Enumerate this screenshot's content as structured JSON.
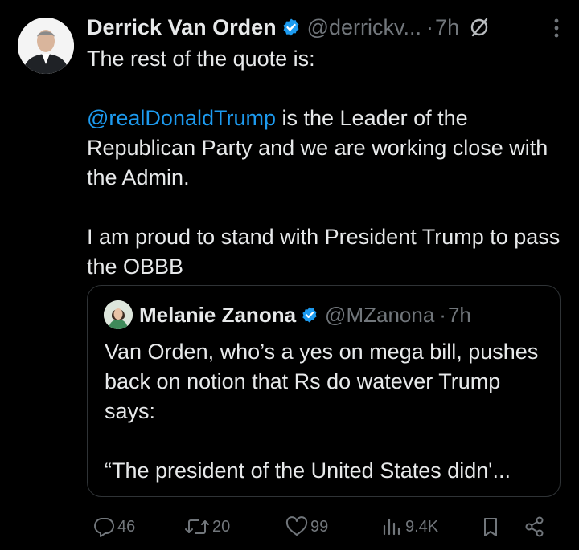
{
  "post": {
    "author_name": "Derrick Van Orden",
    "author_handle": "@derrickv...",
    "separator": "·",
    "time": "7h",
    "paragraphs": {
      "p1": "The rest of the quote is:",
      "p2_mention": "@realDonaldTrump",
      "p2_text": " is the Leader of the Republican Party and we are working close with the Admin.",
      "p3": "I am proud to stand with President Trump to pass the OBBB"
    }
  },
  "quoted_post": {
    "author_name": "Melanie Zanona",
    "author_handle": "@MZanona",
    "separator": "·",
    "time": "7h",
    "p1": "Van Orden, who’s a yes on mega bill, pushes back on notion that Rs do watever Trump says:",
    "p2": "“The president of the United States didn'..."
  },
  "actions": {
    "replies": "46",
    "reposts": "20",
    "likes": "99",
    "views": "9.4K"
  },
  "icons": {
    "verified": "verified-badge-icon",
    "reply": "reply-icon",
    "repost": "repost-icon",
    "like": "heart-icon",
    "views": "views-icon",
    "bookmark": "bookmark-icon",
    "share": "share-icon",
    "more": "more-icon",
    "no": "no-symbol-icon"
  },
  "colors": {
    "background": "#000000",
    "text": "#e7e9ea",
    "secondary": "#71767b",
    "link": "#1d9bf0",
    "border": "#2f3336"
  }
}
